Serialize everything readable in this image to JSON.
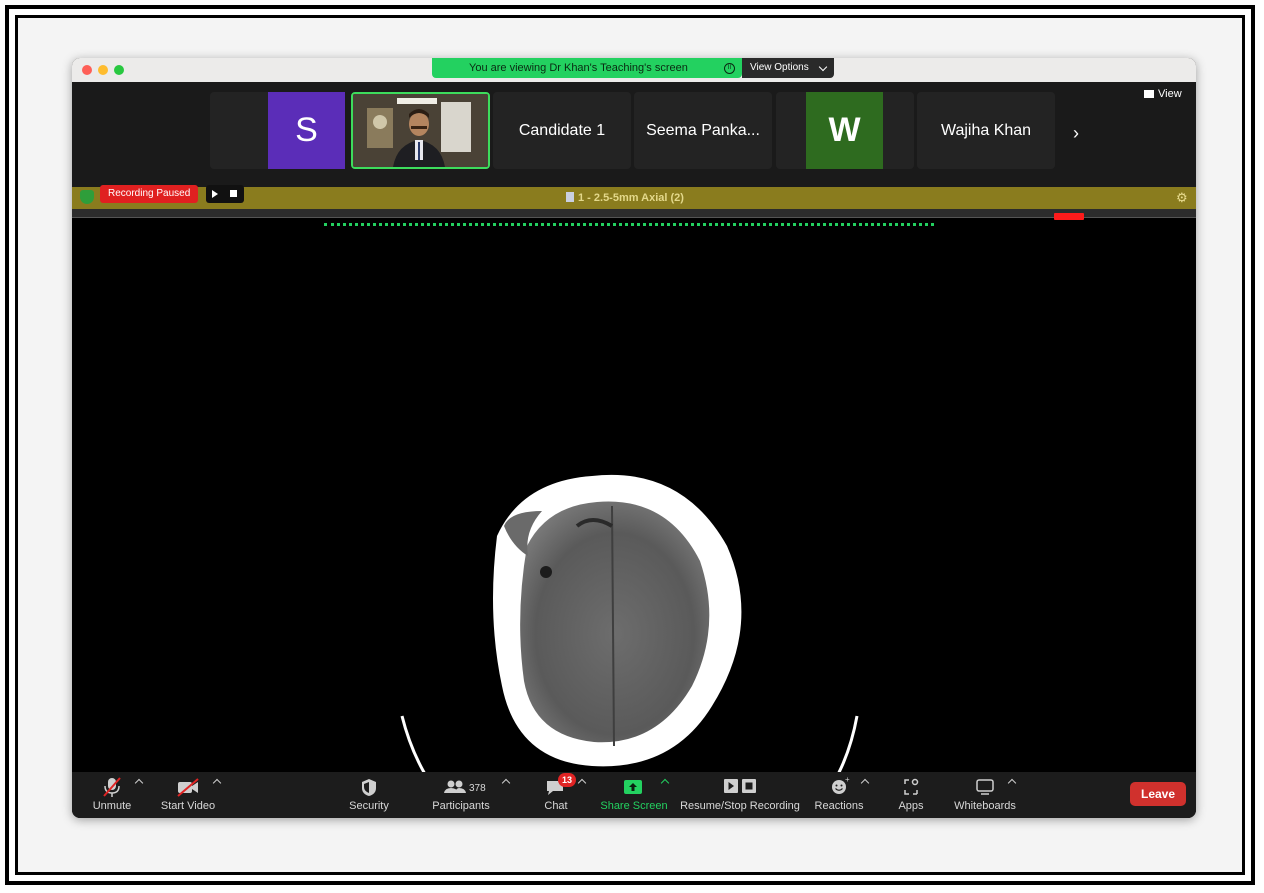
{
  "share_banner": {
    "text": "You are viewing Dr Khan's Teaching's screen",
    "view_options_label": "View Options"
  },
  "gallery": {
    "tiles": [
      {
        "type": "avatar",
        "initial": "S",
        "color": "#5b2db8"
      },
      {
        "type": "video"
      },
      {
        "type": "name",
        "name": "Candidate 1"
      },
      {
        "type": "name",
        "name": "Seema Panka..."
      },
      {
        "type": "avatar",
        "initial": "W",
        "color": "#2e6b1f"
      },
      {
        "type": "name",
        "name": "Wajiha Khan"
      }
    ],
    "view_label": "View"
  },
  "recording": {
    "status": "Recording Paused"
  },
  "viewer": {
    "series_title": "1 - 2.5-5mm Axial (2)"
  },
  "toolbar": {
    "unmute": "Unmute",
    "start_video": "Start Video",
    "security": "Security",
    "participants": "Participants",
    "participant_count": "378",
    "chat": "Chat",
    "chat_badge": "13",
    "share_screen": "Share Screen",
    "resume_stop_recording": "Resume/Stop Recording",
    "reactions": "Reactions",
    "apps": "Apps",
    "whiteboards": "Whiteboards",
    "leave": "Leave"
  },
  "colors": {
    "share_green": "#23d160",
    "leave_red": "#d0312d",
    "recording_red": "#e02020",
    "viewer_bar": "#8a7c1e"
  }
}
